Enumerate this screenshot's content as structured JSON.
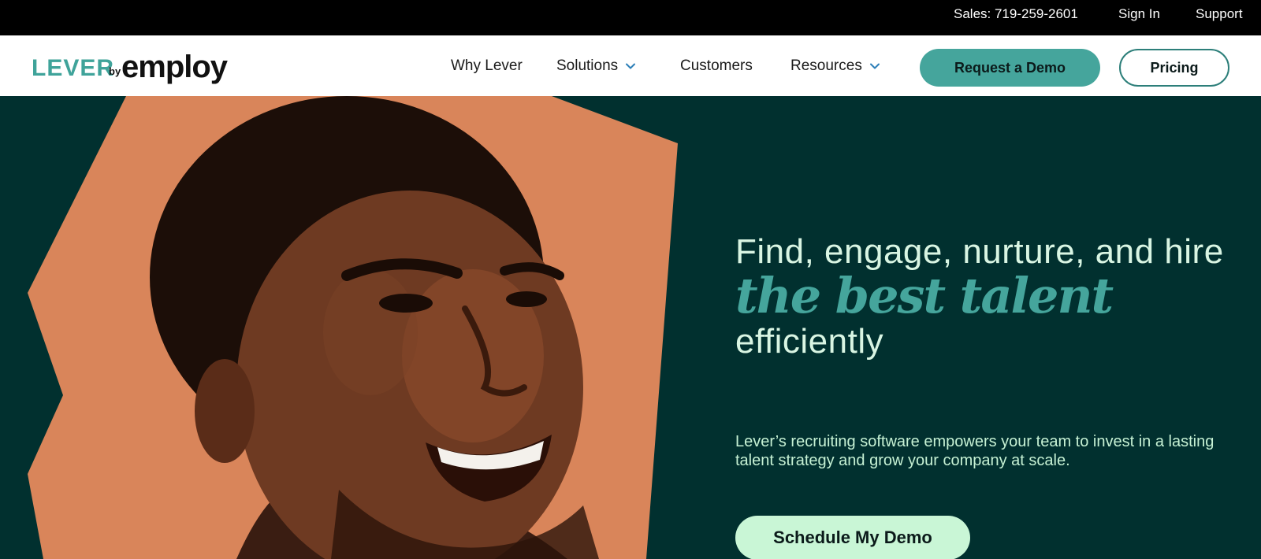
{
  "topbar": {
    "sales": "Sales: 719-259-2601",
    "sign_in": "Sign In",
    "support": "Support"
  },
  "logo": {
    "brand": "LEVER",
    "by": "by",
    "parent": "employ"
  },
  "nav": {
    "items": [
      {
        "label": "Why Lever",
        "has_dropdown": false
      },
      {
        "label": "Solutions",
        "has_dropdown": true
      },
      {
        "label": "Customers",
        "has_dropdown": false
      },
      {
        "label": "Resources",
        "has_dropdown": true
      }
    ],
    "request_demo": "Request a Demo",
    "pricing": "Pricing"
  },
  "hero": {
    "headline_line1": "Find, engage, nurture, and hire",
    "headline_accent": "the best talent",
    "headline_line3": "efficiently",
    "subcopy": "Lever’s recruiting software empowers your team to invest in a lasting talent strategy and grow your company at scale.",
    "cta": "Schedule My Demo"
  },
  "colors": {
    "topbar_bg": "#000000",
    "hero_bg": "#01302f",
    "accent_teal": "#45a59c",
    "headline_text": "#d9f5e3",
    "cta_bg": "#c9f6d6",
    "portrait_bg": "#d9855a"
  }
}
